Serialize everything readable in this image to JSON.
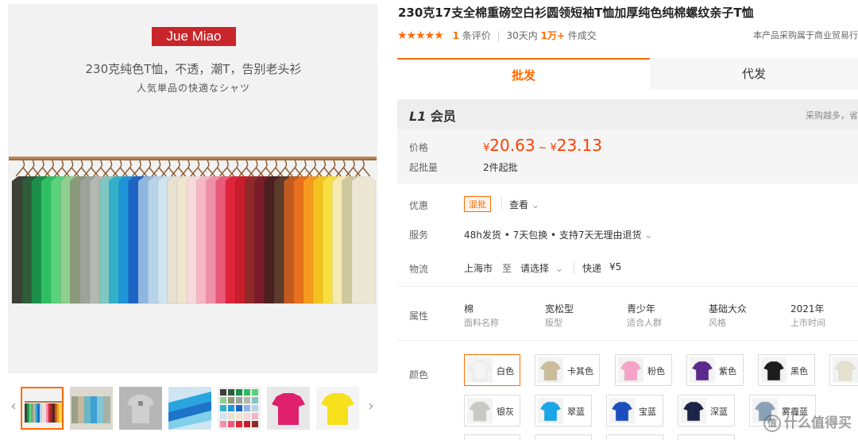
{
  "gallery": {
    "brand": "Jue Miao",
    "tagline": "230克纯色T恤，不透，潮T，告别老头衫",
    "tagline_jp": "人気単品の快適なシャツ",
    "prev_icon": "chevron-left-icon",
    "next_icon": "chevron-right-icon",
    "shirt_colors": [
      "#3d4037",
      "#2f5b3a",
      "#1b8f4a",
      "#2fbf63",
      "#5ad27a",
      "#8fcf8f",
      "#8a9a7a",
      "#9ca39a",
      "#b4b8b0",
      "#7fc7c0",
      "#33b0c8",
      "#1f95d8",
      "#1d64c4",
      "#8fb6e0",
      "#b6d3ea",
      "#cfe4ef",
      "#e8e0d0",
      "#f0e6cf",
      "#f7d8dc",
      "#f6b6c4",
      "#f090a8",
      "#e85a78",
      "#e0243a",
      "#c81d2a",
      "#8e2a2a",
      "#7a1c2a",
      "#4a2020",
      "#5c3a2c",
      "#c05a1e",
      "#e8701e",
      "#f59a1e",
      "#f4c21e",
      "#f7df40",
      "#f5eab0",
      "#d0c9a0",
      "#ece7d5"
    ]
  },
  "product": {
    "title": "230克17支全棉重磅空白衫圆领短袖T恤加厚纯色纯棉螺纹亲子T恤",
    "stars": "★★★★★",
    "review_count": "1",
    "review_label": "条评价",
    "sold_prefix": "30天内",
    "sold_count": "1万+",
    "sold_suffix": "件成交",
    "compliance": "本产品采购属于商业贸易行"
  },
  "tabs": [
    {
      "label": "批发",
      "active": true
    },
    {
      "label": "代发",
      "active": false
    }
  ],
  "pricing": {
    "member_level": "L1",
    "member_label": "会员",
    "member_note": "采购越多，省",
    "price_label": "价格",
    "currency": "¥",
    "price_low": "20.63",
    "tilde": "~",
    "price_high": "23.13",
    "min_label": "起批量",
    "min_value": "2件起批"
  },
  "offers": {
    "label": "优惠",
    "badge": "混批",
    "view": "查看"
  },
  "service": {
    "label": "服务",
    "items": "48h发货 • 7天包换 • 支持7天无理由退货"
  },
  "shipping": {
    "label": "物流",
    "from": "上海市",
    "to_word": "至",
    "select": "请选择",
    "method": "快递",
    "fee": "¥5"
  },
  "attributes": {
    "label": "属性",
    "items": [
      {
        "value": "棉",
        "name": "面料名称"
      },
      {
        "value": "宽松型",
        "name": "版型"
      },
      {
        "value": "青少年",
        "name": "适合人群"
      },
      {
        "value": "基础大众",
        "name": "风格"
      },
      {
        "value": "2021年",
        "name": "上市时间"
      }
    ]
  },
  "colors": {
    "label": "颜色",
    "options": [
      {
        "name": "白色",
        "hex": "#f4f4f4",
        "selected": true
      },
      {
        "name": "卡其色",
        "hex": "#cbbd9a",
        "selected": false
      },
      {
        "name": "粉色",
        "hex": "#f6a3c9",
        "selected": false
      },
      {
        "name": "紫色",
        "hex": "#5b2a8c",
        "selected": false
      },
      {
        "name": "黑色",
        "hex": "#1c1c1c",
        "selected": false
      },
      {
        "name": "",
        "hex": "#e6e0cf",
        "selected": false
      },
      {
        "name": "银灰",
        "hex": "#c9c9c4",
        "selected": false
      },
      {
        "name": "翠蓝",
        "hex": "#1ba6e8",
        "selected": false
      },
      {
        "name": "宝蓝",
        "hex": "#1b4fc0",
        "selected": false
      },
      {
        "name": "深蓝",
        "hex": "#1c2548",
        "selected": false
      },
      {
        "name": "雾霾蓝",
        "hex": "#8aa2b8",
        "selected": false
      }
    ]
  },
  "watermark": {
    "icon": "zhi-icon",
    "icon_glyph": "值",
    "text": "什么值得买"
  }
}
